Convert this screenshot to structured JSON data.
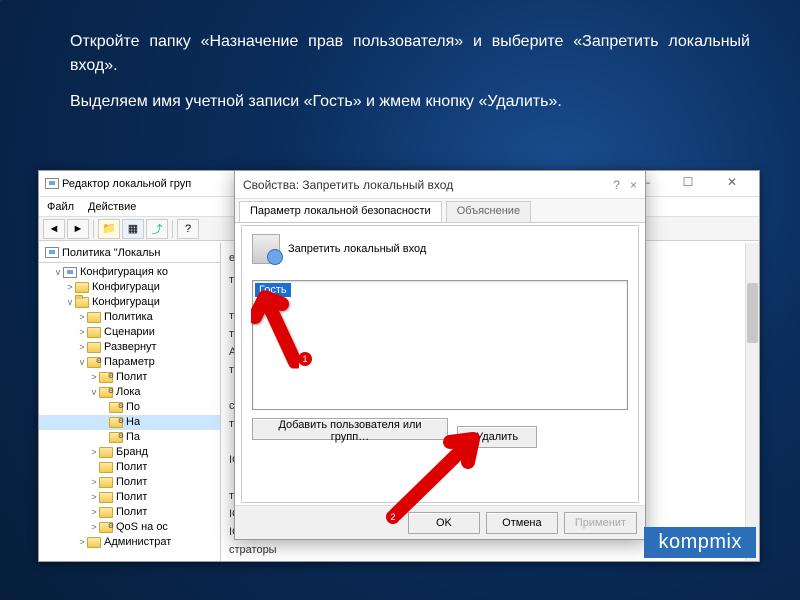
{
  "slide": {
    "p1": "Откройте папку «Назначение прав пользователя» и выберите «Запретить локальный вход».",
    "p2": "Выделяем имя учетной записи «Гость» и жмем кнопку «Удалить»."
  },
  "mmc": {
    "title": "Редактор локальной груп",
    "menu": {
      "file": "Файл",
      "action": "Действие"
    },
    "root": "Политика \"Локальн",
    "tree": {
      "n1": "Конфигурация ко",
      "n11": "Конфигураци",
      "n12": "Конфигураци",
      "n121": "Политика",
      "n122": "Сценарии",
      "n123": "Развернут",
      "n124": "Параметр",
      "n1241": "Полит",
      "n1242": "Лока",
      "n12421": "По",
      "n12422": "На",
      "n12423": "Па",
      "n1243": "Бранд",
      "n1244": "Полит",
      "n1245": "Полит",
      "n1246": "Полит",
      "n1247": "Полит",
      "n1248": "QoS на ос",
      "n2": "Администрат"
    }
  },
  "details": {
    "head": "езопасности",
    "c1": "торы, Опер…",
    "c2": "торы, Опер…",
    "c3": "торы, Опер…",
    "c4": "ALL SERVIC…",
    "c5": "торы",
    "c6": "стораторы,…",
    "c7": "торы, Поль…",
    "c8": "ICE, NETWO…",
    "c9": "торы",
    "c10": "ICE, Админ…",
    "c11": "ICE, Админ…",
    "c12": "страторы"
  },
  "dialog": {
    "title": "Свойства: Запретить локальный вход",
    "help": "?",
    "close": "×",
    "tab1": "Параметр локальной безопасности",
    "tab2": "Объяснение",
    "policy_label": "Запретить локальный вход",
    "item": "Гость",
    "add": "Добавить пользователя или групп…",
    "remove": "Удалить",
    "ok": "OK",
    "cancel": "Отмена",
    "apply": "Применит"
  },
  "annotations": {
    "one": "1",
    "two": "2"
  },
  "watermark": "kompmix"
}
